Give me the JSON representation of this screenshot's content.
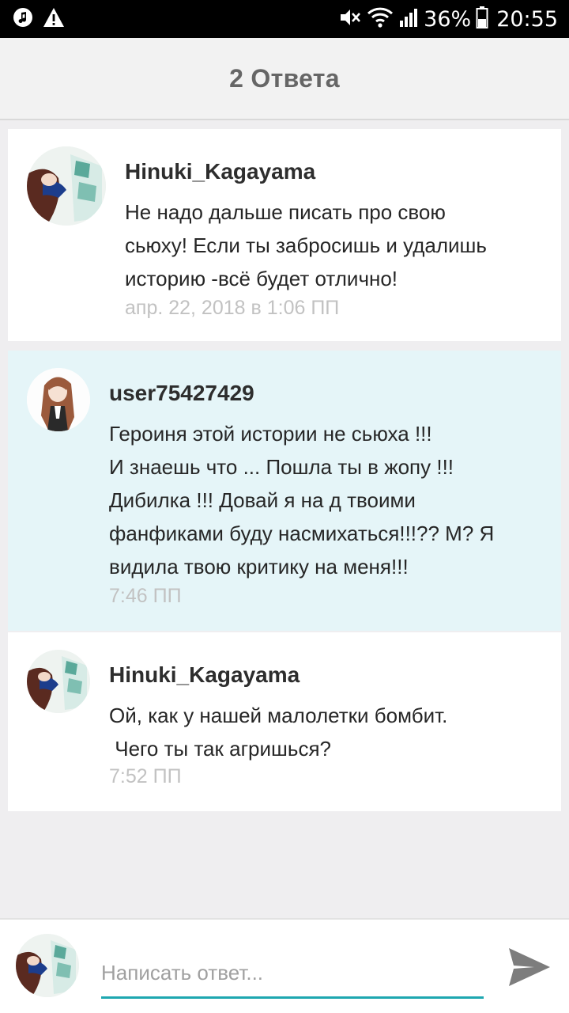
{
  "status_bar": {
    "battery": "36%",
    "time": "20:55",
    "icons": [
      "music-icon",
      "warning-icon",
      "mute-icon",
      "wifi-icon",
      "signal-icon",
      "battery-icon"
    ]
  },
  "header": {
    "title": "2 Ответа"
  },
  "comments": [
    {
      "author": "Hinuki_Kagayama",
      "text": "Не надо дальше писать про свою\nсьюху! Если ты забросишь и удалишь\nисторию -всё будет отлично!",
      "time": "апр. 22, 2018 в 1:06 ПП",
      "highlighted": false
    },
    {
      "author": "user75427429",
      "text": "Героиня этой истории не сьюха !!!\nИ знаешь что ... Пошла ты в жопу !!!\nДибилка !!! Довай я на д твоими\nфанфиками буду насмихаться!!!?? М? Я\nвидила твою критику на меня!!!",
      "time": "7:46 ПП",
      "highlighted": true
    },
    {
      "author": "Hinuki_Kagayama",
      "text": "Ой, как у нашей малолетки бомбит.\n Чего ты так агришься?",
      "time": "7:52 ПП",
      "highlighted": false
    }
  ],
  "composer": {
    "placeholder": "Написать ответ...",
    "value": ""
  },
  "colors": {
    "accent": "#1ea7b0",
    "highlight_bg": "#e5f5f8",
    "page_bg": "#efeef0"
  }
}
